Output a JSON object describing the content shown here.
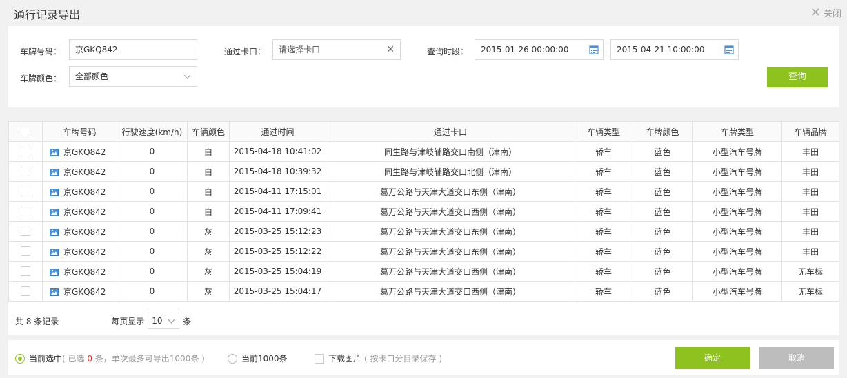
{
  "dialog": {
    "title": "通行记录导出",
    "close_label": "关闭"
  },
  "filters": {
    "plate_label": "车牌号码：",
    "plate_value": "京GKQ842",
    "checkpoint_label": "通过卡口：",
    "checkpoint_placeholder": "请选择卡口",
    "period_label": "查询时段：",
    "start_time": "2015-01-26 00:00:00",
    "range_sep": "-",
    "end_time": "2015-04-21 10:00:00",
    "color_label": "车牌颜色：",
    "color_value": "全部颜色",
    "query_button": "查询"
  },
  "table": {
    "columns": [
      "车牌号码",
      "行驶速度(km/h)",
      "车辆颜色",
      "通过时间",
      "通过卡口",
      "车辆类型",
      "车牌颜色",
      "车牌类型",
      "车辆品牌"
    ],
    "rows": [
      {
        "plate": "京GKQ842",
        "speed": "0",
        "color": "白",
        "time": "2015-04-18 10:41:02",
        "checkpoint": "同生路与津岐辅路交口南侧（津南）",
        "vtype": "轿车",
        "pcolor": "蓝色",
        "ptype": "小型汽车号牌",
        "brand": "丰田"
      },
      {
        "plate": "京GKQ842",
        "speed": "0",
        "color": "白",
        "time": "2015-04-18 10:39:32",
        "checkpoint": "同生路与津岐辅路交口北侧（津南）",
        "vtype": "轿车",
        "pcolor": "蓝色",
        "ptype": "小型汽车号牌",
        "brand": "丰田"
      },
      {
        "plate": "京GKQ842",
        "speed": "0",
        "color": "白",
        "time": "2015-04-11 17:15:01",
        "checkpoint": "葛万公路与天津大道交口东侧（津南）",
        "vtype": "轿车",
        "pcolor": "蓝色",
        "ptype": "小型汽车号牌",
        "brand": "丰田"
      },
      {
        "plate": "京GKQ842",
        "speed": "0",
        "color": "白",
        "time": "2015-04-11 17:09:41",
        "checkpoint": "葛万公路与天津大道交口西侧（津南）",
        "vtype": "轿车",
        "pcolor": "蓝色",
        "ptype": "小型汽车号牌",
        "brand": "丰田"
      },
      {
        "plate": "京GKQ842",
        "speed": "0",
        "color": "灰",
        "time": "2015-03-25 15:12:23",
        "checkpoint": "葛万公路与天津大道交口东侧（津南）",
        "vtype": "轿车",
        "pcolor": "蓝色",
        "ptype": "小型汽车号牌",
        "brand": "丰田"
      },
      {
        "plate": "京GKQ842",
        "speed": "0",
        "color": "灰",
        "time": "2015-03-25 15:12:22",
        "checkpoint": "葛万公路与天津大道交口东侧（津南）",
        "vtype": "轿车",
        "pcolor": "蓝色",
        "ptype": "小型汽车号牌",
        "brand": "丰田"
      },
      {
        "plate": "京GKQ842",
        "speed": "0",
        "color": "灰",
        "time": "2015-03-25 15:04:19",
        "checkpoint": "葛万公路与天津大道交口西侧（津南）",
        "vtype": "轿车",
        "pcolor": "蓝色",
        "ptype": "小型汽车号牌",
        "brand": "无车标"
      },
      {
        "plate": "京GKQ842",
        "speed": "0",
        "color": "灰",
        "time": "2015-03-25 15:04:17",
        "checkpoint": "葛万公路与天津大道交口西侧（津南）",
        "vtype": "轿车",
        "pcolor": "蓝色",
        "ptype": "小型汽车号牌",
        "brand": "无车标"
      }
    ]
  },
  "pagination": {
    "total_text": "共 8 条记录",
    "per_page_label": "每页显示",
    "per_page_value": "10",
    "per_page_unit": "条"
  },
  "export": {
    "opt_selected_label": "当前选中",
    "opt_selected_hint_prefix": "( 已选 ",
    "opt_selected_count": "0",
    "opt_selected_hint_suffix": " 条，单次最多可导出1000条 )",
    "opt_1000_label": "当前1000条",
    "opt_images_label": "下载图片",
    "opt_images_hint": "( 按卡口分目录保存 )",
    "ok_button": "确定",
    "cancel_button": "取消"
  },
  "colors": {
    "accent": "#8dc21f",
    "cancel": "#bdbdbd",
    "count_red": "#e52b2b",
    "image_icon": "#4a90d9"
  },
  "icons": {
    "close": "close-icon",
    "clear": "clear-icon",
    "calendar": "calendar-icon",
    "dropdown": "chevron-down-icon",
    "row_image": "image-icon"
  }
}
